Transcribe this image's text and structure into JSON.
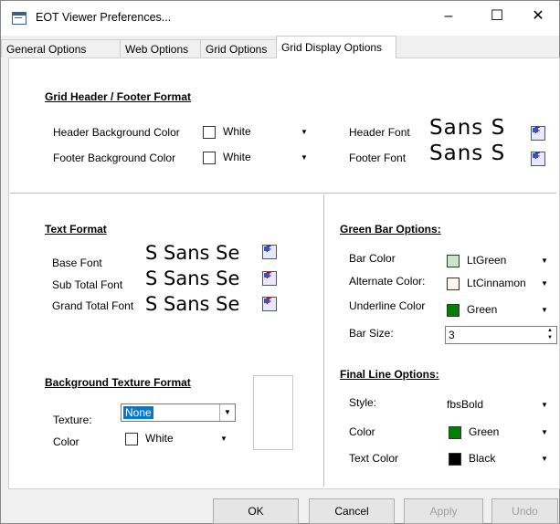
{
  "window": {
    "title": "EOT Viewer Preferences...",
    "minimize_glyph": "–",
    "maximize_glyph": "☐",
    "close_glyph": "✕"
  },
  "tabs": [
    {
      "label": "General Options"
    },
    {
      "label": "Web Options"
    },
    {
      "label": "Grid Options"
    },
    {
      "label": "Grid Display Options"
    }
  ],
  "header_footer": {
    "title": "Grid Header / Footer Format",
    "header_bg_label": "Header Background Color",
    "header_bg_value": "White",
    "header_bg_color": "#ffffff",
    "footer_bg_label": "Footer Background Color",
    "footer_bg_value": "White",
    "footer_bg_color": "#ffffff",
    "header_font_label": "Header Font",
    "header_font_preview": "Sans S",
    "footer_font_label": "Footer Font",
    "footer_font_preview": "Sans S"
  },
  "text_format": {
    "title": "Text Format",
    "base_font_label": "Base Font",
    "base_font_preview": "S Sans Se",
    "sub_total_label": "Sub Total Font",
    "sub_total_preview": "S Sans Se",
    "grand_total_label": "Grand Total Font",
    "grand_total_preview": "S Sans Se"
  },
  "background_texture": {
    "title": "Background Texture Format",
    "texture_label": "Texture:",
    "texture_value": "None",
    "color_label": "Color",
    "color_value": "White",
    "color_hex": "#ffffff"
  },
  "green_bar": {
    "title": "Green Bar Options:",
    "bar_color_label": "Bar Color",
    "bar_color_value": "LtGreen",
    "bar_color_hex": "#c8e8c8",
    "alt_color_label": "Alternate Color:",
    "alt_color_value": "LtCinnamon",
    "alt_color_hex": "#fff6ee",
    "underline_label": "Underline Color",
    "underline_value": "Green",
    "underline_hex": "#008000",
    "bar_size_label": "Bar Size:",
    "bar_size_value": "3"
  },
  "final_line": {
    "title": "Final Line Options:",
    "style_label": "Style:",
    "style_value": "fbsBold",
    "color_label": "Color",
    "color_value": "Green",
    "color_hex": "#008000",
    "text_color_label": "Text Color",
    "text_color_value": "Black",
    "text_color_hex": "#000000"
  },
  "buttons": {
    "ok": "OK",
    "cancel": "Cancel",
    "apply": "Apply",
    "undo": "Undo"
  }
}
